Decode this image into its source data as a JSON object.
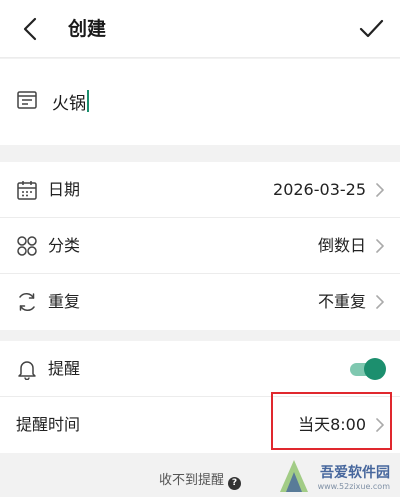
{
  "header": {
    "title": "创建",
    "back_icon": "chevron-left-icon",
    "confirm_icon": "check-icon"
  },
  "name_field": {
    "icon": "note-icon",
    "value": "火锅"
  },
  "settings": {
    "date": {
      "icon": "calendar-icon",
      "label": "日期",
      "value": "2026-03-25"
    },
    "category": {
      "icon": "grid-icon",
      "label": "分类",
      "value": "倒数日"
    },
    "repeat": {
      "icon": "repeat-icon",
      "label": "重复",
      "value": "不重复"
    }
  },
  "reminder": {
    "toggle_row": {
      "icon": "bell-icon",
      "label": "提醒",
      "enabled": true
    },
    "time_row": {
      "label": "提醒时间",
      "value": "当天8:00"
    }
  },
  "footer": {
    "hint": "收不到提醒",
    "help_icon": "question-circle-icon",
    "help_glyph": "?"
  },
  "watermark": {
    "title": "吾爱软件园",
    "url": "www.52zixue.com"
  },
  "colors": {
    "accent": "#1c8f6e",
    "accent_light": "#7fc8b0",
    "highlight_box": "#e0282e",
    "background": "#f2f2f2"
  }
}
